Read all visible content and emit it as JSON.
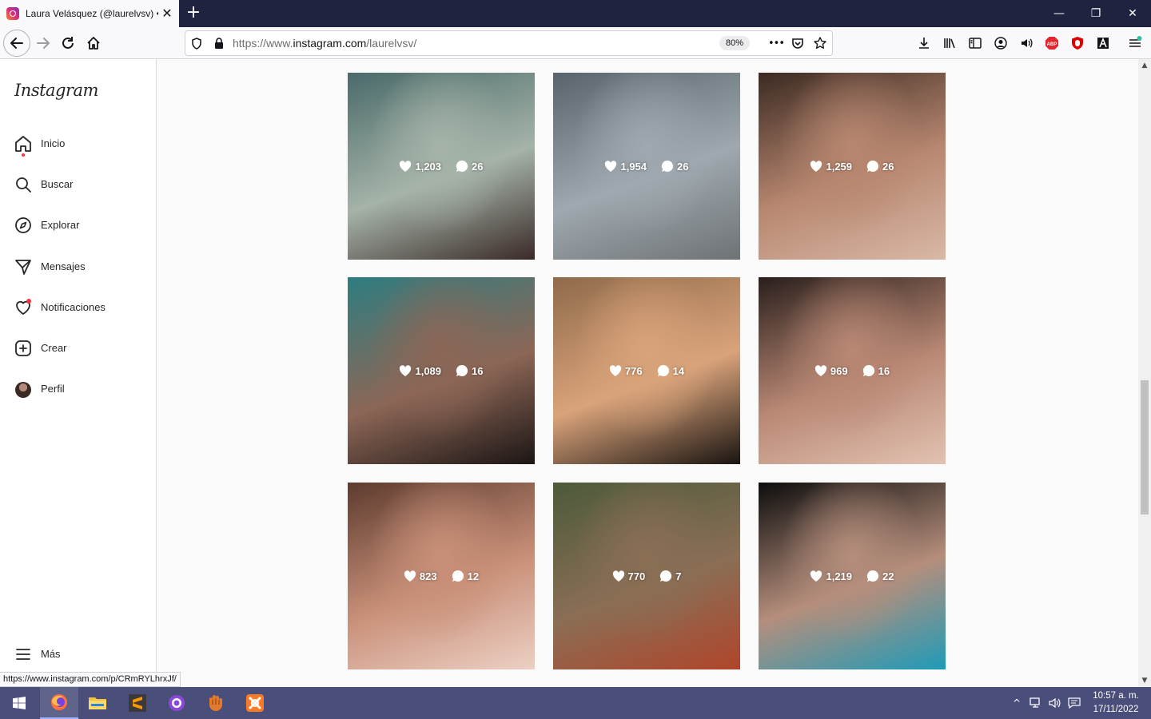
{
  "browser": {
    "tab_title": "Laura Velásquez (@laurelvsv) • I",
    "tab_close": "✕",
    "new_tab": "+",
    "window_controls": {
      "minimize": "—",
      "restore": "❐",
      "close": "✕"
    },
    "url_prefix": "https://www.",
    "url_domain": "instagram.com",
    "url_path": "/laurelvsv/",
    "zoom": "80%",
    "page_actions_label": "•••",
    "status_link": "https://www.instagram.com/p/CRmRYLhrxJf/"
  },
  "sidebar": {
    "logo": "Instagram",
    "items": [
      {
        "label": "Inicio",
        "icon": "home-icon"
      },
      {
        "label": "Buscar",
        "icon": "search-icon"
      },
      {
        "label": "Explorar",
        "icon": "compass-icon"
      },
      {
        "label": "Mensajes",
        "icon": "send-icon"
      },
      {
        "label": "Notificaciones",
        "icon": "heart-icon"
      },
      {
        "label": "Crear",
        "icon": "plus-square-icon"
      },
      {
        "label": "Perfil",
        "icon": "avatar"
      }
    ],
    "more_label": "Más"
  },
  "posts": [
    {
      "likes": "1,203",
      "comments": "26",
      "colors": [
        "#4a6a6a",
        "#a5b3a8",
        "#3a2a28"
      ]
    },
    {
      "likes": "1,954",
      "comments": "26",
      "colors": [
        "#58636b",
        "#9ea8ae",
        "#6e7275"
      ]
    },
    {
      "likes": "1,259",
      "comments": "26",
      "colors": [
        "#3b2a22",
        "#b88770",
        "#d8b8a6"
      ]
    },
    {
      "likes": "1,089",
      "comments": "16",
      "colors": [
        "#2e7d80",
        "#8c6656",
        "#1c1615"
      ]
    },
    {
      "likes": "776",
      "comments": "14",
      "colors": [
        "#8f6a4a",
        "#d9a37a",
        "#1a1411"
      ]
    },
    {
      "likes": "969",
      "comments": "16",
      "colors": [
        "#2a1f1c",
        "#b98874",
        "#e2c2b2"
      ]
    },
    {
      "likes": "823",
      "comments": "12",
      "colors": [
        "#5d3b2e",
        "#c99079",
        "#ecd0c4"
      ]
    },
    {
      "likes": "770",
      "comments": "7",
      "colors": [
        "#4c5a3a",
        "#8a6e55",
        "#b0452a"
      ]
    },
    {
      "likes": "1,219",
      "comments": "22",
      "colors": [
        "#0d0d0d",
        "#b58e7c",
        "#1f9bb8"
      ]
    }
  ],
  "taskbar": {
    "apps": [
      "windows-start-icon",
      "firefox-icon",
      "file-explorer-icon",
      "sublime-text-icon",
      "github-desktop-icon",
      "baseball-glove-icon",
      "xampp-icon"
    ],
    "time": "10:57 a. m.",
    "date": "17/11/2022"
  }
}
